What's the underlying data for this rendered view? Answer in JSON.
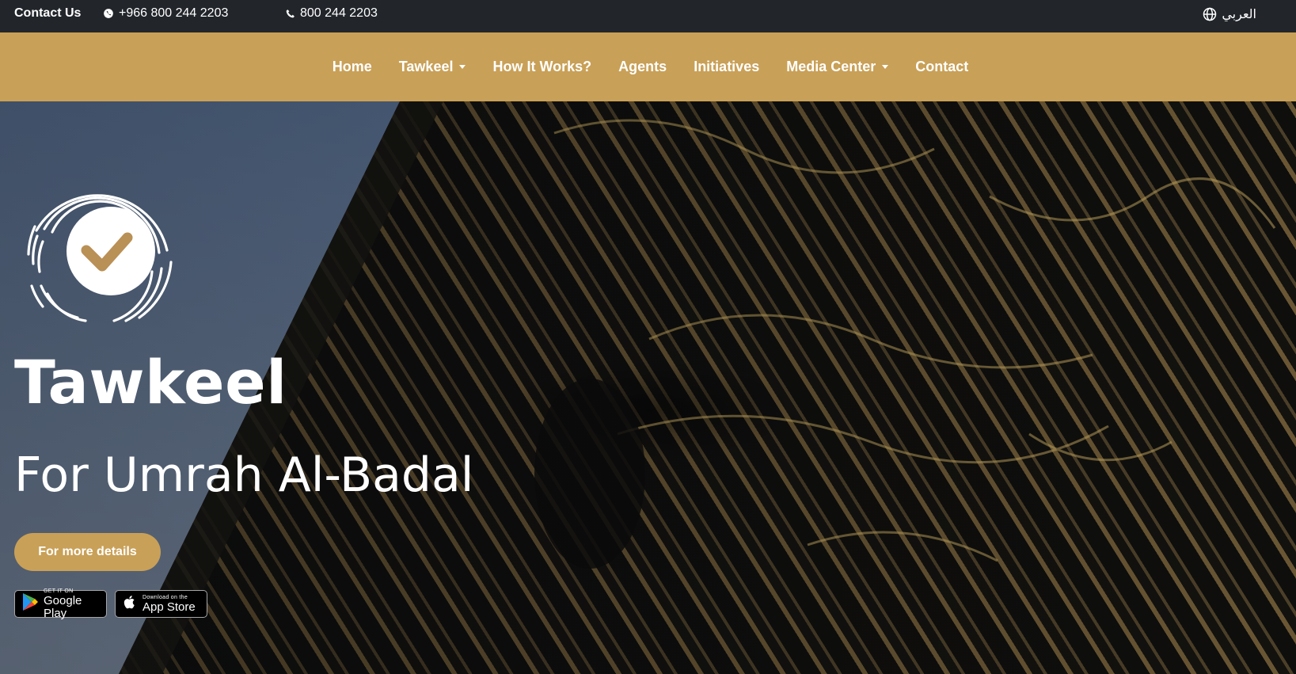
{
  "topbar": {
    "contact_label": "Contact Us",
    "whatsapp_number": "+966 800 244 2203",
    "phone_number": "800 244 2203",
    "language_label": "العربي",
    "icons": {
      "whatsapp": "whatsapp-icon",
      "phone": "phone-icon",
      "language": "globe-icon"
    }
  },
  "nav": {
    "items": [
      {
        "label": "Home",
        "has_dropdown": false
      },
      {
        "label": "Tawkeel",
        "has_dropdown": true
      },
      {
        "label": "How It Works?",
        "has_dropdown": false
      },
      {
        "label": "Agents",
        "has_dropdown": false
      },
      {
        "label": "Initiatives",
        "has_dropdown": false
      },
      {
        "label": "Media Center",
        "has_dropdown": true
      },
      {
        "label": "Contact",
        "has_dropdown": false
      }
    ]
  },
  "hero": {
    "title": "Tawkeel",
    "subtitle": "For Umrah Al-Badal",
    "cta_label": "For more details",
    "logo_icon": "fingerprint-check-icon",
    "stores": {
      "google": {
        "small": "GET IT ON",
        "big": "Google Play"
      },
      "apple": {
        "small": "Download on the",
        "big": "App Store"
      }
    }
  },
  "colors": {
    "accent_gold": "#c9a057",
    "topbar_bg": "#22262b",
    "text_white": "#ffffff"
  }
}
